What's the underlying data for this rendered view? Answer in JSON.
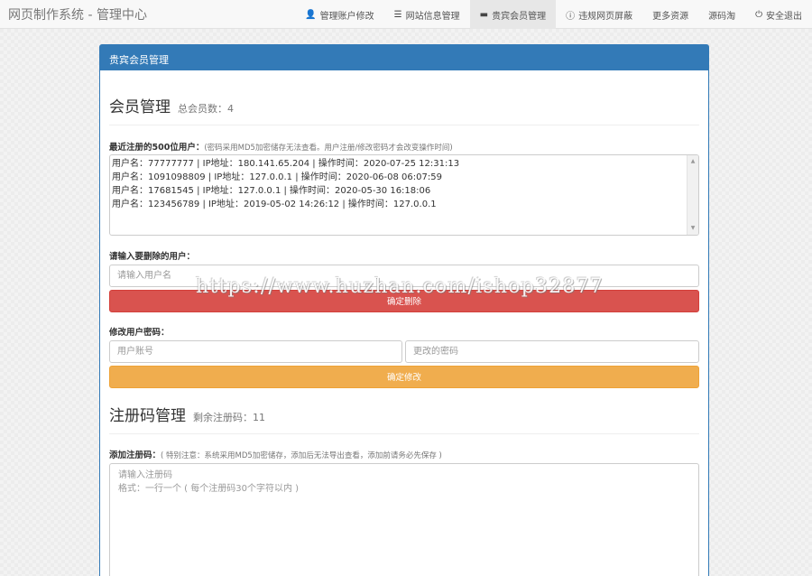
{
  "navbar": {
    "brand": "网页制作系统 - 管理中心",
    "items": [
      {
        "icon": "user-icon",
        "glyph": "👤",
        "label": "管理账户修改"
      },
      {
        "icon": "list-icon",
        "glyph": "☰",
        "label": "网站信息管理"
      },
      {
        "icon": "comment-icon",
        "glyph": "▬",
        "label": "贵宾会员管理"
      },
      {
        "icon": "exclamation-icon",
        "glyph": "ⓘ",
        "label": "违规网页屏蔽"
      },
      {
        "icon": "",
        "glyph": "",
        "label": "更多资源"
      },
      {
        "icon": "",
        "glyph": "",
        "label": "源码淘"
      },
      {
        "icon": "power-icon",
        "glyph": "⏻",
        "label": "安全退出"
      }
    ]
  },
  "panel": {
    "heading": "贵宾会员管理",
    "member": {
      "title": "会员管理",
      "count_label": "总会员数：4",
      "recent_label": "最近注册的500位用户：",
      "recent_note": "(密码采用MD5加密储存无法查看。用户注册/修改密码才会改变操作时间)",
      "log_lines": [
        "用户名：77777777  |  IP地址：180.141.65.204  |  操作时间：2020-07-25 12:31:13",
        "用户名：1091098809  |  IP地址：127.0.0.1  |  操作时间：2020-06-08 06:07:59",
        "用户名：17681545  |  IP地址：127.0.0.1  |  操作时间：2020-05-30 16:18:06",
        "用户名：123456789  |  IP地址：2019-05-02 14:26:12  |  操作时间：127.0.0.1"
      ],
      "delete_label": "请输入要删除的用户：",
      "delete_placeholder": "请输入用户名",
      "delete_button": "确定删除",
      "change_label": "修改用户密码：",
      "account_placeholder": "用户账号",
      "password_placeholder": "更改的密码",
      "change_button": "确定修改"
    },
    "regcode": {
      "title": "注册码管理",
      "remaining_label": "剩余注册码：11",
      "add_label": "添加注册码：",
      "add_note": "( 特别注意：系统采用MD5加密储存，添加后无法导出查看，添加前请务必先保存 )",
      "textarea_placeholder": "请输入注册码\n格式：一行一个 ( 每个注册码30个字符以内 )"
    }
  },
  "watermark": "https://www.huzhan.com/ishop32877"
}
